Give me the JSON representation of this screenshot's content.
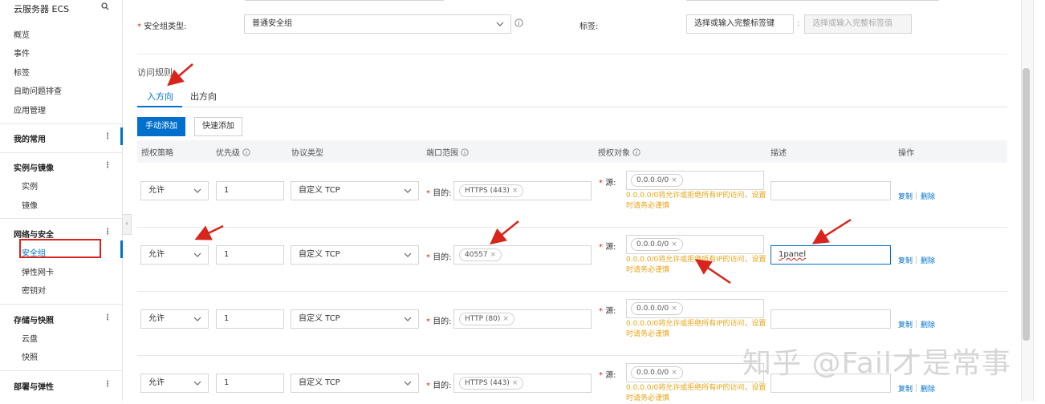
{
  "sidebar": {
    "title": "云服务器 ECS",
    "top_items": [
      "概览",
      "事件",
      "标签",
      "自助问题排查",
      "应用管理"
    ],
    "groups": [
      {
        "label": "我的常用",
        "items": []
      },
      {
        "label": "实例与镜像",
        "items": [
          "实例",
          "镜像"
        ]
      },
      {
        "label": "网络与安全",
        "items": [
          "安全组",
          "弹性网卡",
          "密钥对"
        ]
      },
      {
        "label": "存储与快照",
        "items": [
          "云盘",
          "快照"
        ]
      },
      {
        "label": "部署与弹性",
        "items": []
      }
    ],
    "dots": "⋮",
    "collapse": "‹"
  },
  "form": {
    "sg_type_label": "安全组类型:",
    "sg_type_value": "普通安全组",
    "tag_label": "标签:",
    "tag_key_placeholder": "选择或输入完整标签键",
    "tag_colon": ":",
    "tag_value_placeholder": "选择或输入完整标签值"
  },
  "rules": {
    "section_title": "访问规则",
    "tabs": [
      "入方向",
      "出方向"
    ],
    "btn_manual": "手动添加",
    "btn_quick": "快速添加",
    "headers": [
      "授权策略",
      "优先级",
      "协议类型",
      "端口范围",
      "授权对象",
      "描述",
      "操作"
    ],
    "dest_label": "目的:",
    "src_label": "源:",
    "hint_line1": "0.0.0.0/0将允许或拒绝所有IP的访问，设置",
    "hint_line2": "时请务必谨慎",
    "rows": [
      {
        "policy": "允许",
        "priority": "1",
        "protocol": "自定义 TCP",
        "port_tag": "HTTPS (443)",
        "source_tag": "0.0.0.0/0",
        "desc": "",
        "copy": "复制",
        "delete": "删除"
      },
      {
        "policy": "允许",
        "priority": "1",
        "protocol": "自定义 TCP",
        "port_tag": "40557",
        "source_tag": "0.0.0.0/0",
        "desc": "1panel",
        "copy": "复制",
        "delete": "删除"
      },
      {
        "policy": "允许",
        "priority": "1",
        "protocol": "自定义 TCP",
        "port_tag": "HTTP (80)",
        "source_tag": "0.0.0.0/0",
        "desc": "",
        "copy": "复制",
        "delete": "删除"
      },
      {
        "policy": "允许",
        "priority": "1",
        "protocol": "自定义 TCP",
        "port_tag": "HTTPS (443)",
        "source_tag": "0.0.0.0/0",
        "desc": "",
        "copy": "复制",
        "delete": "删除"
      }
    ]
  },
  "watermark": "知乎 @Fail才是常事",
  "colors": {
    "primary": "#0070cc",
    "required": "#d9241b",
    "warning": "#e8a417",
    "annotation_arrow": "#d9241b"
  }
}
